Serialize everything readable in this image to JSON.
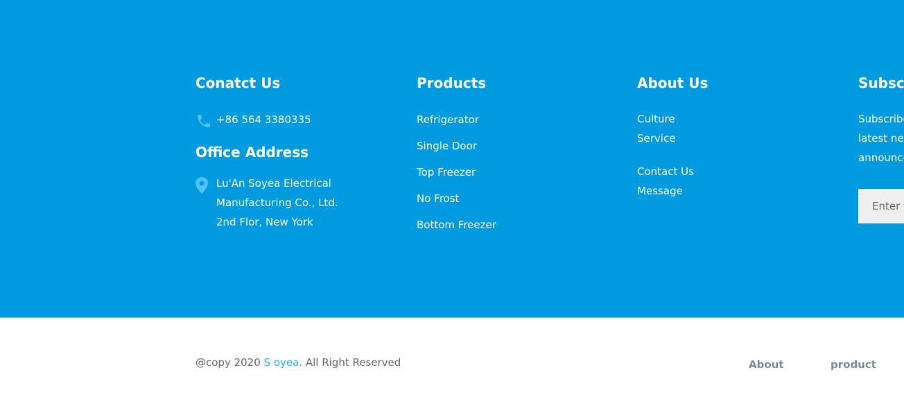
{
  "contact": {
    "title": "Conatct Us",
    "phone": "+86 564 3380335",
    "office_title": "Office Address",
    "address_lines": [
      "Lu'An Soyea Electrical",
      "Manufacturing Co., Ltd.",
      "2nd Flor, New York"
    ]
  },
  "products": {
    "title": "Products",
    "items": [
      "Refrigerator",
      "Single Door",
      "Top Freezer",
      "No Frost",
      "Bottom Freezer"
    ]
  },
  "about": {
    "title": "About Us",
    "group1": [
      "Culture",
      "Service"
    ],
    "group2": [
      "Contact Us",
      "Message"
    ]
  },
  "subscribe": {
    "title": "Subscribe",
    "text_lines": [
      "Subscribe to our",
      "latest news and",
      "announcements"
    ],
    "input_placeholder": "Enter your email"
  },
  "bottom": {
    "copy_prefix": "@copy 2020  ",
    "brand": "S oyea",
    "copy_suffix": ". All Right Reserved",
    "links": [
      "About",
      "product"
    ]
  },
  "colors": {
    "footer_bg": "#009ade",
    "icon_color": "#4fc3f7",
    "brand_color": "#2bb0ea"
  },
  "icons": {
    "phone": "phone-icon",
    "location": "location-pin-icon"
  }
}
